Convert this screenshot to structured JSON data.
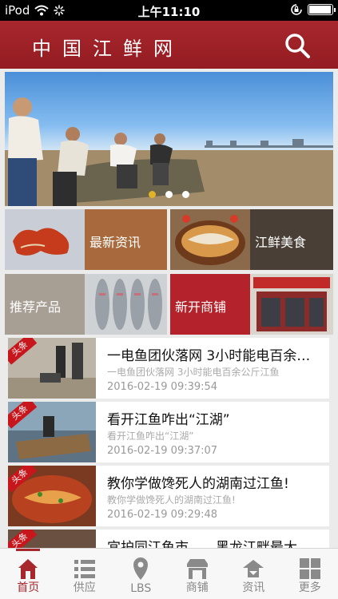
{
  "status_bar": {
    "carrier": "iPod",
    "time": "上午11:10",
    "battery_level": 0.9
  },
  "header": {
    "title": "中国江鲜网",
    "search_icon": "search-icon"
  },
  "banner": {
    "slide_count": 3,
    "active_slide": 1
  },
  "categories": [
    {
      "label": "最新资讯"
    },
    {
      "label": "江鲜美食"
    },
    {
      "label": "推荐产品"
    },
    {
      "label": "新开商铺"
    }
  ],
  "news": [
    {
      "tag": "头条",
      "title": "一电鱼团伙落网 3小时能电百余…",
      "summary": "一电鱼团伙落网 3小时能电百余公斤江鱼",
      "date": "2016-02-19 09:39:54"
    },
    {
      "tag": "头条",
      "title": "看开江鱼咋出“江湖”",
      "summary": "看开江鱼咋出“江湖”",
      "date": "2016-02-19 09:37:07"
    },
    {
      "tag": "头条",
      "title": "教你学做馋死人的湖南过江鱼!",
      "summary": "教你学做馋死人的湖南过江鱼!",
      "date": "2016-02-19 09:29:48"
    },
    {
      "tag": "头条",
      "title": "宜护同江鱼市……黑龙江畔最大",
      "summary": "",
      "date": ""
    }
  ],
  "tabbar": {
    "active": "首页",
    "tabs": [
      {
        "label": "首页",
        "icon": "home-icon"
      },
      {
        "label": "供应",
        "icon": "list-icon"
      },
      {
        "label": "LBS",
        "icon": "location-pin-icon"
      },
      {
        "label": "商铺",
        "icon": "shop-icon"
      },
      {
        "label": "资讯",
        "icon": "news-plane-icon"
      },
      {
        "label": "更多",
        "icon": "grid-icon"
      }
    ]
  },
  "colors": {
    "brand_red": "#a8272d",
    "tag_red": "#c8161d",
    "active_dot": "#e2b229"
  }
}
